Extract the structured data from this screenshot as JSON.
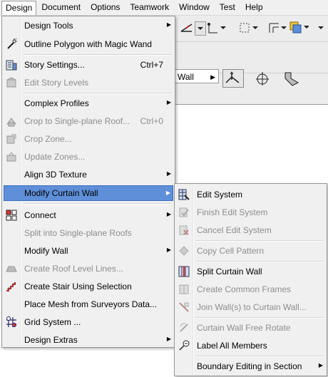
{
  "menubar": {
    "items": [
      "Design",
      "Document",
      "Options",
      "Teamwork",
      "Window",
      "Test",
      "Help"
    ]
  },
  "toolbar": {
    "wall_field": "Wall"
  },
  "design_menu": {
    "items": [
      {
        "label": "Design Tools",
        "submenu": true,
        "enabled": true,
        "icon": "none"
      },
      {
        "label": "Outline Polygon with Magic Wand",
        "enabled": true,
        "icon": "magic-wand-icon"
      },
      {
        "label": "Story Settings...",
        "shortcut": "Ctrl+7",
        "enabled": true,
        "icon": "story-settings-icon"
      },
      {
        "label": "Edit Story Levels",
        "enabled": false,
        "icon": "story-levels-icon"
      },
      {
        "label": "Complex Profiles",
        "submenu": true,
        "enabled": true,
        "icon": "none"
      },
      {
        "label": "Crop to Single-plane Roof...",
        "shortcut": "Ctrl+0",
        "enabled": false,
        "icon": "crop-roof-icon"
      },
      {
        "label": "Crop Zone...",
        "enabled": false,
        "icon": "crop-zone-icon"
      },
      {
        "label": "Update Zones...",
        "enabled": false,
        "icon": "update-zones-icon"
      },
      {
        "label": "Align 3D Texture",
        "submenu": true,
        "enabled": true,
        "icon": "none"
      },
      {
        "label": "Modify Curtain Wall",
        "submenu": true,
        "enabled": true,
        "selected": true,
        "icon": "none"
      },
      {
        "label": "Connect",
        "submenu": true,
        "enabled": true,
        "icon": "connect-icon"
      },
      {
        "label": "Split into Single-plane Roofs",
        "enabled": false,
        "icon": "none"
      },
      {
        "label": "Modify Wall",
        "submenu": true,
        "enabled": true,
        "icon": "none"
      },
      {
        "label": "Create Roof Level Lines...",
        "enabled": false,
        "icon": "roof-level-icon"
      },
      {
        "label": "Create Stair Using Selection",
        "enabled": true,
        "icon": "stair-icon"
      },
      {
        "label": "Place Mesh from Surveyors Data...",
        "enabled": true,
        "icon": "none"
      },
      {
        "label": "Grid System ...",
        "enabled": true,
        "icon": "grid-system-icon"
      },
      {
        "label": "Design Extras",
        "submenu": true,
        "enabled": true,
        "icon": "none"
      }
    ]
  },
  "curtain_wall_submenu": {
    "items": [
      {
        "label": "Edit System",
        "enabled": true,
        "icon": "edit-system-icon"
      },
      {
        "label": "Finish Edit System",
        "enabled": false,
        "icon": "finish-edit-icon"
      },
      {
        "label": "Cancel Edit System",
        "enabled": false,
        "icon": "cancel-edit-icon"
      },
      {
        "label": "Copy Cell Pattern",
        "enabled": false,
        "icon": "copy-cell-icon"
      },
      {
        "label": "Split Curtain Wall",
        "enabled": true,
        "icon": "split-wall-icon"
      },
      {
        "label": "Create Common Frames",
        "enabled": false,
        "icon": "common-frames-icon"
      },
      {
        "label": "Join Wall(s) to Curtain Wall...",
        "enabled": false,
        "icon": "join-wall-icon"
      },
      {
        "label": "Curtain Wall Free Rotate",
        "enabled": false,
        "icon": "free-rotate-icon"
      },
      {
        "label": "Label All Members",
        "enabled": true,
        "icon": "label-members-icon"
      },
      {
        "label": "Boundary Editing in Section",
        "submenu": true,
        "enabled": true,
        "icon": "none"
      }
    ]
  },
  "colors": {
    "selection": "#5e8fd8",
    "menu_bg": "#f0f0f0",
    "disabled_text": "#8d8d8d"
  }
}
